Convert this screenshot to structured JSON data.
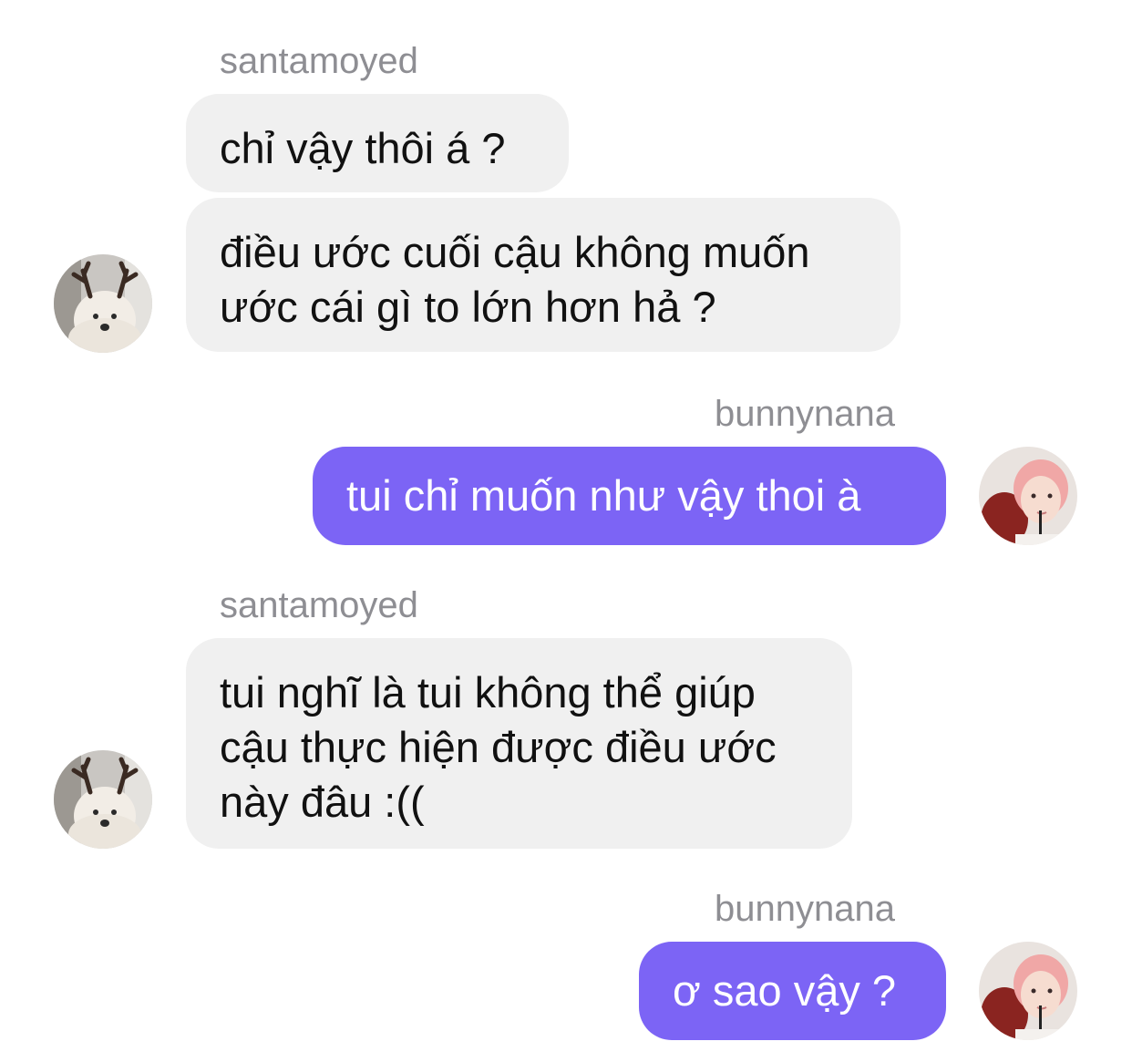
{
  "messages": [
    {
      "sender": "santamoyed",
      "direction": "incoming",
      "bubbles": [
        {
          "lines": [
            "chỉ vậy thôi á ?"
          ]
        },
        {
          "lines": [
            "điều ước cuối cậu không muốn",
            "ước cái gì to lớn hơn hả ?"
          ]
        }
      ]
    },
    {
      "sender": "bunnynana",
      "direction": "outgoing",
      "bubbles": [
        {
          "lines": [
            "tui chỉ muốn như vậy thoi à"
          ]
        }
      ]
    },
    {
      "sender": "santamoyed",
      "direction": "incoming",
      "bubbles": [
        {
          "lines": [
            "tui nghĩ là tui không thể giúp",
            "cậu thực hiện được điều ước",
            "này đâu :(("
          ]
        }
      ]
    },
    {
      "sender": "bunnynana",
      "direction": "outgoing",
      "bubbles": [
        {
          "lines": [
            "ơ sao vậy ?"
          ]
        }
      ]
    }
  ],
  "colors": {
    "incoming_bubble": "#f0f0f0",
    "outgoing_bubble": "#7c64f5",
    "sender_name": "#8e8e93"
  },
  "avatars": {
    "santamoyed": "samoyed-dog-with-reindeer-antlers-avatar",
    "bunnynana": "pink-haired-person-avatar"
  }
}
